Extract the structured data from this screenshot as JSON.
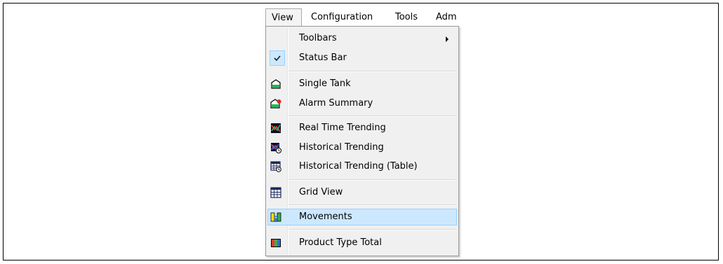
{
  "menubar": {
    "items": [
      {
        "label": "View"
      },
      {
        "label": "Configuration"
      },
      {
        "label": "Tools"
      },
      {
        "label": "Adm"
      }
    ]
  },
  "view_menu": {
    "items": [
      {
        "label": "Toolbars",
        "icon": "submenu-arrow-icon"
      },
      {
        "label": "Status Bar",
        "icon": "checkmark-icon",
        "checked": true
      },
      {
        "label": "Single Tank",
        "icon": "single-tank-icon"
      },
      {
        "label": "Alarm Summary",
        "icon": "alarm-summary-icon"
      },
      {
        "label": "Real Time Trending",
        "icon": "real-time-trending-icon"
      },
      {
        "label": "Historical Trending",
        "icon": "historical-trending-icon"
      },
      {
        "label": "Historical Trending (Table)",
        "icon": "historical-trending-table-icon"
      },
      {
        "label": "Grid View",
        "icon": "grid-view-icon"
      },
      {
        "label": "Movements",
        "icon": "movements-icon",
        "highlighted": true
      },
      {
        "label": "Product Type Total",
        "icon": "product-type-total-icon"
      }
    ]
  },
  "colors": {
    "menu_background": "#f0f0f0",
    "highlight_fill": "#cce8ff",
    "highlight_border": "#99d1ff",
    "tank_green": "#1db954"
  }
}
